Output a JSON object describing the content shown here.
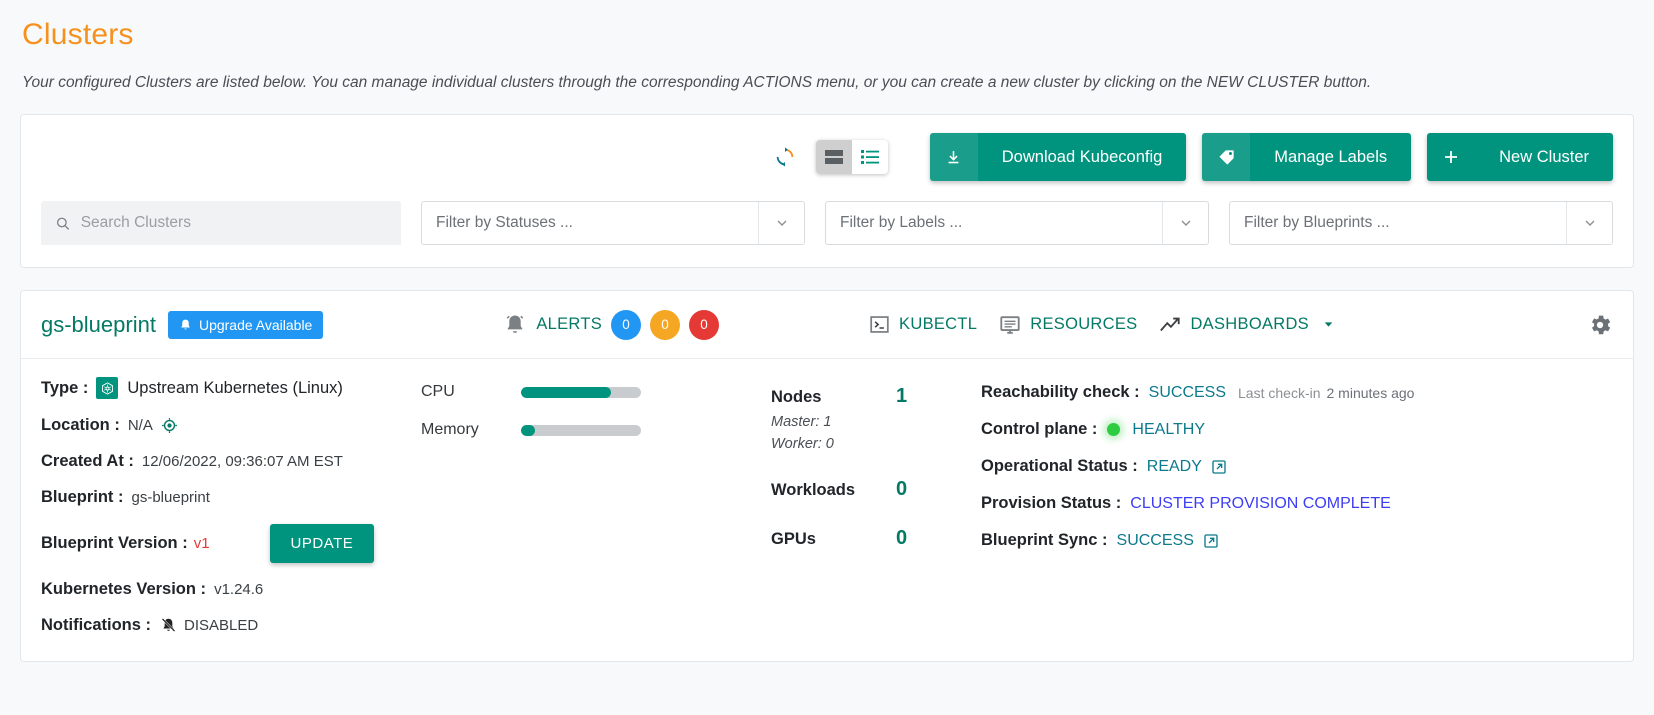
{
  "page": {
    "title": "Clusters",
    "subtitle": "Your configured Clusters are listed below. You can manage individual clusters through the corresponding ACTIONS menu, or you can create a new cluster by clicking on the NEW CLUSTER button."
  },
  "toolbar": {
    "refresh_icon": "refresh-icon",
    "view_card_icon": "card-view-icon",
    "view_list_icon": "list-view-icon",
    "buttons": [
      {
        "label": "Download Kubeconfig",
        "icon": "download-icon"
      },
      {
        "label": "Manage Labels",
        "icon": "tag-icon"
      },
      {
        "label": "New Cluster",
        "icon": "plus-icon"
      }
    ]
  },
  "filters": {
    "search_placeholder": "Search Clusters",
    "search_value": "",
    "search_icon": "search-icon",
    "statuses_placeholder": "Filter by Statuses ...",
    "labels_placeholder": "Filter by Labels ...",
    "blueprints_placeholder": "Filter by Blueprints ..."
  },
  "cluster": {
    "name": "gs-blueprint",
    "upgrade_badge": "Upgrade Available",
    "alerts_label": "ALERTS",
    "alerts": [
      {
        "count": "0",
        "color": "#2196f3"
      },
      {
        "count": "0",
        "color": "#f5a623"
      },
      {
        "count": "0",
        "color": "#e53935"
      }
    ],
    "actions": [
      {
        "label": "KUBECTL",
        "icon": "terminal-icon"
      },
      {
        "label": "RESOURCES",
        "icon": "monitor-icon"
      },
      {
        "label": "DASHBOARDS",
        "icon": "trending-up-icon"
      }
    ],
    "settings_icon": "gear-icon",
    "details": {
      "type_key": "Type :",
      "type_value": "Upstream Kubernetes (Linux)",
      "location_key": "Location :",
      "location_value": "N/A",
      "created_key": "Created At :",
      "created_value": "12/06/2022, 09:36:07 AM EST",
      "blueprint_key": "Blueprint :",
      "blueprint_value": "gs-blueprint",
      "blueprint_version_key": "Blueprint Version :",
      "blueprint_version_value": "v1",
      "update_button": "UPDATE",
      "k8s_version_key": "Kubernetes Version :",
      "k8s_version_value": "v1.24.6",
      "notifications_key": "Notifications :",
      "notifications_value": "DISABLED"
    },
    "gauges": [
      {
        "label": "CPU",
        "percent": 75
      },
      {
        "label": "Memory",
        "percent": 12
      }
    ],
    "counts": {
      "nodes_label": "Nodes",
      "nodes_value": "1",
      "master": "Master: 1",
      "worker": "Worker: 0",
      "workloads_label": "Workloads",
      "workloads_value": "0",
      "gpus_label": "GPUs",
      "gpus_value": "0"
    },
    "status": {
      "reachability_key": "Reachability check :",
      "reachability_value": "SUCCESS",
      "last_checkin_label": "Last check-in",
      "last_checkin_value": "2 minutes ago",
      "control_plane_key": "Control plane :",
      "control_plane_value": "HEALTHY",
      "operational_key": "Operational Status :",
      "operational_value": "READY",
      "provision_key": "Provision Status :",
      "provision_value": "CLUSTER PROVISION COMPLETE",
      "blueprint_sync_key": "Blueprint Sync :",
      "blueprint_sync_value": "SUCCESS"
    }
  }
}
